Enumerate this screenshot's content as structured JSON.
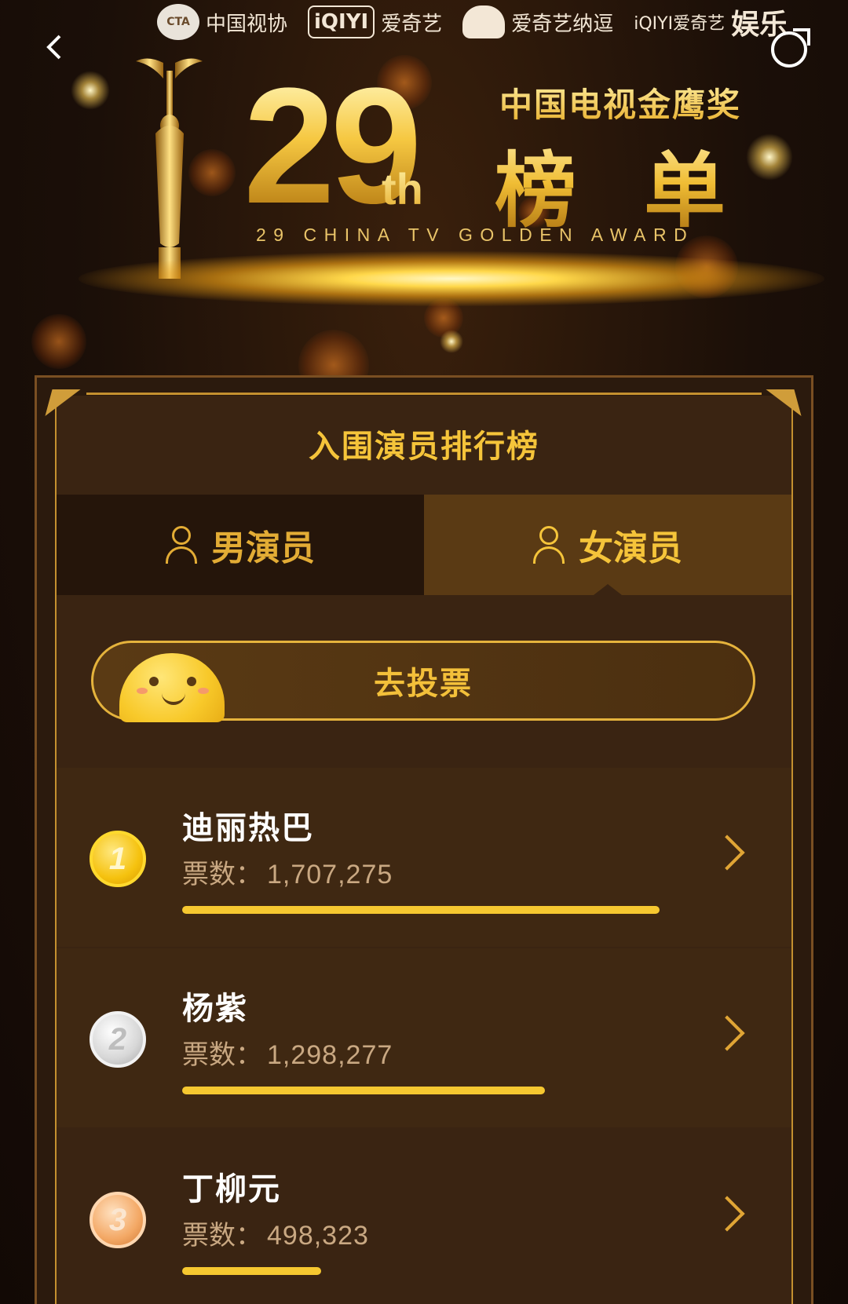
{
  "header": {
    "logos": [
      {
        "name": "中国视协"
      },
      {
        "name": "爱奇艺",
        "badge": "iQIYI"
      },
      {
        "name": "爱奇艺纳逗"
      },
      {
        "name": "娱乐",
        "prefix": "iQIYI爱奇艺"
      }
    ],
    "back_icon": "chevron-left-icon",
    "share_icon": "share-icon"
  },
  "banner": {
    "number": "29",
    "suffix": "th",
    "award_cn": "中国电视金鹰奖",
    "title": "榜单",
    "award_en": "29 CHINA TV GOLDEN AWARD"
  },
  "panel": {
    "title": "入围演员排行榜",
    "tabs": [
      {
        "label": "男演员",
        "icon": "male-person-icon",
        "selected": false
      },
      {
        "label": "女演员",
        "icon": "female-person-icon",
        "selected": true
      }
    ],
    "vote_button": "去投票",
    "votes_prefix": "票数：",
    "ranking": [
      {
        "rank": "1",
        "name": "迪丽热巴",
        "votes": "1,707,275",
        "votes_value": 1707275,
        "medal": "gold"
      },
      {
        "rank": "2",
        "name": "杨紫",
        "votes": "1,298,277",
        "votes_value": 1298277,
        "medal": "silver"
      },
      {
        "rank": "3",
        "name": "丁柳元",
        "votes": "498,323",
        "votes_value": 498323,
        "medal": "bronze"
      }
    ]
  },
  "colors": {
    "accent": "#f5c43a",
    "background": "#1a0e07",
    "bar": "#f6c830"
  }
}
